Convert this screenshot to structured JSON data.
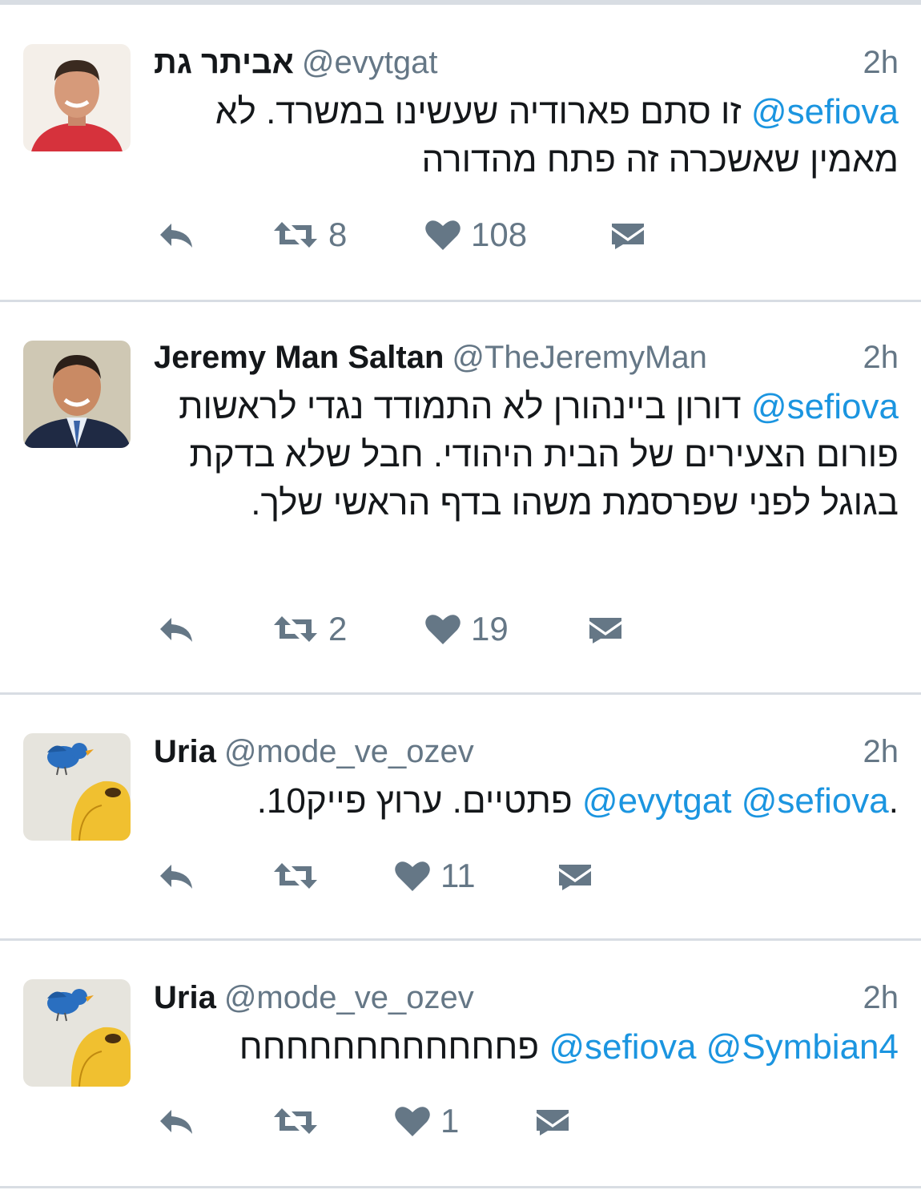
{
  "colors": {
    "text": "#14171a",
    "secondary": "#657786",
    "mention": "#1b95e0",
    "divider": "#d8dde3"
  },
  "icons": {
    "reply": "reply-icon",
    "retweet": "retweet-icon",
    "like": "heart-icon",
    "dm": "envelope-icon"
  },
  "tweets": [
    {
      "name": "אביתר גת",
      "handle": "@evytgat",
      "time": "2h",
      "mention1": "@sefiova",
      "text": " זו סתם פארודיה שעשינו במשרד. לא מאמין שאשכרה זה פתח מהדורה",
      "retweets": "8",
      "likes": "108"
    },
    {
      "name": "Jeremy Man Saltan",
      "handle": "@TheJeremyMan",
      "time": "2h",
      "mention1": "@sefiova",
      "text": " דורון ביינהורן לא התמודד נגדי לראשות פורום הצעירים של הבית היהודי. חבל שלא בדקת בגוגל לפני שפרסמת משהו בדף הראשי שלך.",
      "retweets": "2",
      "likes": "19"
    },
    {
      "name": "Uria",
      "handle": "@mode_ve_ozev",
      "time": "2h",
      "mention1": "@evytgat",
      "mention2": "@sefiova",
      "text_before": " פתטיים. ערוץ פייק10.",
      "text_after": ".",
      "retweets": "",
      "likes": "11"
    },
    {
      "name": "Uria",
      "handle": "@mode_ve_ozev",
      "time": "2h",
      "mention1": "@sefiova",
      "mention2": "@Symbian4",
      "text": " פחחחחחחחחחחחח",
      "retweets": "",
      "likes": "1"
    }
  ]
}
